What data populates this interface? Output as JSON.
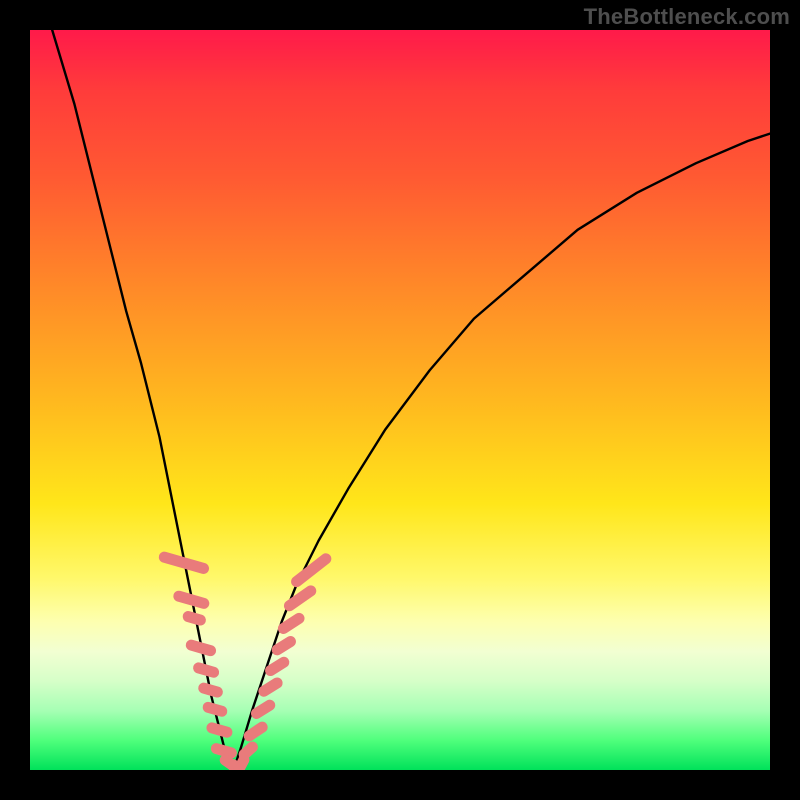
{
  "watermark": "TheBottleneck.com",
  "chart_data": {
    "type": "line",
    "title": "",
    "xlabel": "",
    "ylabel": "",
    "xlim": [
      0,
      100
    ],
    "ylim": [
      0,
      100
    ],
    "grid": false,
    "series": [
      {
        "name": "left-branch",
        "x": [
          3,
          6,
          9,
          11,
          13,
          15,
          16.5,
          17.5,
          18.5,
          19.5,
          20.5,
          21.5,
          22.5,
          23.5,
          24.5,
          25.5,
          26.5,
          27.5
        ],
        "values": [
          100,
          90,
          78,
          70,
          62,
          55,
          49,
          45,
          40,
          35,
          30,
          25,
          20,
          15,
          10,
          6,
          2,
          0
        ]
      },
      {
        "name": "right-branch",
        "x": [
          27.5,
          28.5,
          30,
          32,
          34,
          36,
          39,
          43,
          48,
          54,
          60,
          67,
          74,
          82,
          90,
          97,
          100
        ],
        "values": [
          0,
          3,
          8,
          14,
          20,
          25,
          31,
          38,
          46,
          54,
          61,
          67,
          73,
          78,
          82,
          85,
          86
        ]
      }
    ],
    "highlight_points": {
      "name": "highlight-pills",
      "color": "#e97b7b",
      "points": [
        {
          "x": 20.8,
          "y": 28,
          "len": 7,
          "angle": 74
        },
        {
          "x": 21.8,
          "y": 23,
          "len": 5,
          "angle": 74
        },
        {
          "x": 22.2,
          "y": 20.5,
          "len": 3.2,
          "angle": 74
        },
        {
          "x": 23.1,
          "y": 16.5,
          "len": 4.2,
          "angle": 74
        },
        {
          "x": 23.8,
          "y": 13.5,
          "len": 3.6,
          "angle": 74
        },
        {
          "x": 24.4,
          "y": 10.8,
          "len": 3.4,
          "angle": 74
        },
        {
          "x": 25.0,
          "y": 8.2,
          "len": 3.4,
          "angle": 74
        },
        {
          "x": 25.6,
          "y": 5.4,
          "len": 3.6,
          "angle": 74
        },
        {
          "x": 26.2,
          "y": 2.6,
          "len": 3.6,
          "angle": 74
        },
        {
          "x": 27.0,
          "y": 0.9,
          "len": 3.0,
          "angle": 55
        },
        {
          "x": 27.7,
          "y": 0.1,
          "len": 2.8,
          "angle": 20
        },
        {
          "x": 28.6,
          "y": 0.8,
          "len": 2.8,
          "angle": -28
        },
        {
          "x": 29.5,
          "y": 2.6,
          "len": 3.0,
          "angle": -48
        },
        {
          "x": 30.5,
          "y": 5.2,
          "len": 3.6,
          "angle": -56
        },
        {
          "x": 31.5,
          "y": 8.2,
          "len": 3.6,
          "angle": -58
        },
        {
          "x": 32.5,
          "y": 11.2,
          "len": 3.6,
          "angle": -58
        },
        {
          "x": 33.4,
          "y": 14.0,
          "len": 3.6,
          "angle": -58
        },
        {
          "x": 34.3,
          "y": 16.8,
          "len": 3.6,
          "angle": -58
        },
        {
          "x": 35.3,
          "y": 19.8,
          "len": 4.0,
          "angle": -57
        },
        {
          "x": 36.5,
          "y": 23.2,
          "len": 5.0,
          "angle": -55
        },
        {
          "x": 38.0,
          "y": 27.0,
          "len": 6.5,
          "angle": -52
        }
      ]
    },
    "background_gradient_stops": [
      {
        "pos": 0,
        "color": "#ff1a4a"
      },
      {
        "pos": 35,
        "color": "#ff8a28"
      },
      {
        "pos": 64,
        "color": "#ffe61a"
      },
      {
        "pos": 84,
        "color": "#f2ffd2"
      },
      {
        "pos": 100,
        "color": "#00e25a"
      }
    ]
  }
}
